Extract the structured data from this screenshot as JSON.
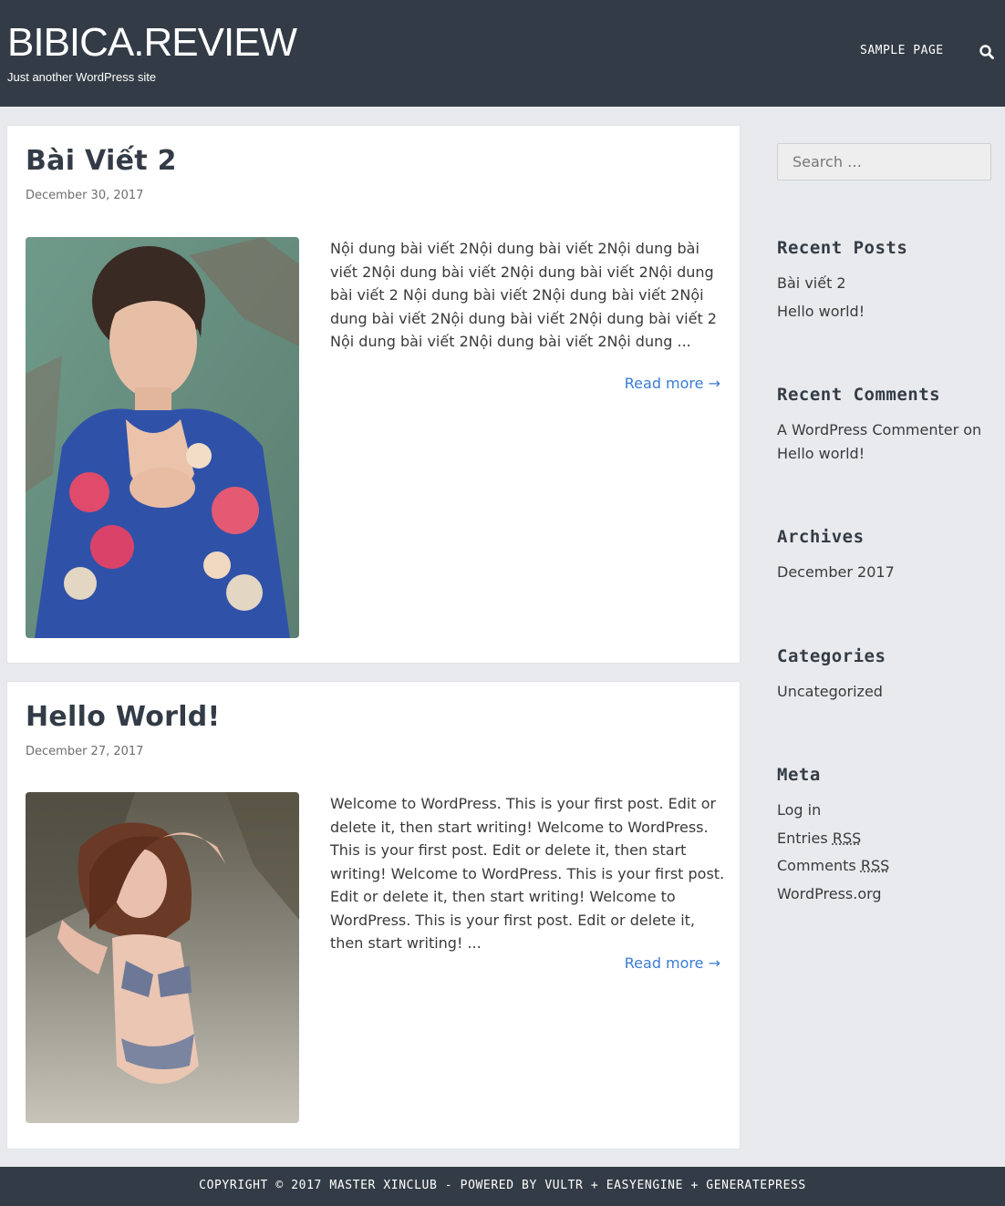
{
  "header": {
    "site_title": "BIBICA.REVIEW",
    "tagline": "Just another WordPress site",
    "nav": [
      {
        "label": "SAMPLE PAGE"
      }
    ],
    "search_icon": "search-icon"
  },
  "posts": [
    {
      "title": "Bài Viết 2",
      "date": "December 30, 2017",
      "excerpt": "Nội dung bài viết 2Nội dung bài viết 2Nội dung bài viết 2Nội dung bài viết 2Nội dung bài viết 2Nội dung bài viết 2 Nội dung bài viết 2Nội dung bài viết 2Nội dung bài viết 2Nội dung bài viết 2Nội dung bài viết 2 Nội dung bài viết 2Nội dung bài viết 2Nội dung ...",
      "read_more": "Read more →"
    },
    {
      "title": "Hello World!",
      "date": "December 27, 2017",
      "excerpt": "Welcome to WordPress. This is your first post. Edit or delete it, then start writing! Welcome to WordPress. This is your first post. Edit or delete it, then start writing! Welcome to WordPress. This is your first post. Edit or delete it, then start writing! Welcome to WordPress. This is your first post. Edit or delete it, then start writing! ...",
      "read_more": "Read more →"
    }
  ],
  "sidebar": {
    "search_placeholder": "Search …",
    "recent_posts": {
      "title": "Recent Posts",
      "items": [
        "Bài viết 2",
        "Hello world!"
      ]
    },
    "recent_comments": {
      "title": "Recent Comments",
      "author": "A WordPress Commenter",
      "on": "on",
      "post": "Hello world!"
    },
    "archives": {
      "title": "Archives",
      "items": [
        "December 2017"
      ]
    },
    "categories": {
      "title": "Categories",
      "items": [
        "Uncategorized"
      ]
    },
    "meta": {
      "title": "Meta",
      "login": "Log in",
      "entries": "Entries",
      "comments": "Comments",
      "rss": "RSS",
      "wordpress": "WordPress.org"
    }
  },
  "footer": {
    "text": "COPYRIGHT © 2017 MASTER XINCLUB - POWERED BY VULTR + EASYENGINE + GENERATEPRESS"
  }
}
